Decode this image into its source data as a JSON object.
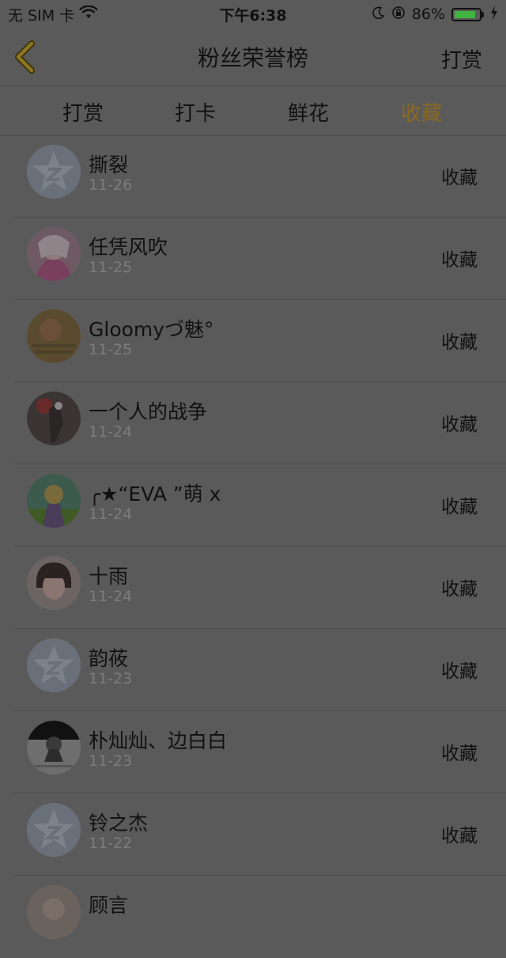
{
  "status_bar": {
    "carrier": "无 SIM 卡",
    "time": "下午6:38",
    "battery_percent": "86%",
    "battery_level": 0.86,
    "wifi_icon": "wifi-icon",
    "moon_icon": "moon-icon",
    "orientation_lock_icon": "orientation-lock-icon",
    "charging_icon": "charging-bolt-icon"
  },
  "nav": {
    "back_icon": "chevron-left-icon",
    "title": "粉丝荣誉榜",
    "right_label": "打赏"
  },
  "tabs": [
    {
      "label": "打赏",
      "active": false
    },
    {
      "label": "打卡",
      "active": false
    },
    {
      "label": "鲜花",
      "active": false
    },
    {
      "label": "收藏",
      "active": true
    }
  ],
  "colors": {
    "active_tab": "#8a6a24",
    "background": "#5a5a5a",
    "date_text": "#7c7c7c"
  },
  "list": [
    {
      "name": "撕裂",
      "date": "11-26",
      "action": "收藏",
      "avatar": "default-star-avatar"
    },
    {
      "name": "任凭风吹",
      "date": "11-25",
      "action": "收藏",
      "avatar": "anime-girl-avatar"
    },
    {
      "name": "Gloomyづ魅°",
      "date": "11-25",
      "action": "收藏",
      "avatar": "text-photo-avatar"
    },
    {
      "name": "一个人的战争",
      "date": "11-24",
      "action": "收藏",
      "avatar": "dark-figure-avatar"
    },
    {
      "name": "╭★“EVA ”萌 x",
      "date": "11-24",
      "action": "收藏",
      "avatar": "colorful-character-avatar"
    },
    {
      "name": "十雨",
      "date": "11-24",
      "action": "收藏",
      "avatar": "child-photo-avatar"
    },
    {
      "name": "韵莜",
      "date": "11-23",
      "action": "收藏",
      "avatar": "default-star-avatar"
    },
    {
      "name": "朴灿灿、边白白",
      "date": "11-23",
      "action": "收藏",
      "avatar": "bw-figure-avatar"
    },
    {
      "name": "铃之杰",
      "date": "11-22",
      "action": "收藏",
      "avatar": "default-star-avatar"
    },
    {
      "name": "顾言",
      "date": "",
      "action": "",
      "avatar": "photo-avatar"
    }
  ]
}
